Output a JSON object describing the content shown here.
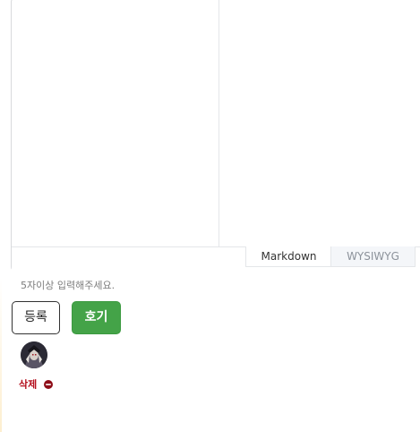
{
  "editor": {
    "tabs": [
      {
        "label": "Markdown",
        "active": true
      },
      {
        "label": "WYSIWYG",
        "active": false
      }
    ]
  },
  "help_text": "5자이상 입력해주세요.",
  "buttons": {
    "register_label": "등록",
    "hogi_label": "호기"
  },
  "attachment": {
    "delete_label": "삭제"
  },
  "colors": {
    "hogi_button": "#44a348",
    "delete_text": "#b40f1d"
  }
}
